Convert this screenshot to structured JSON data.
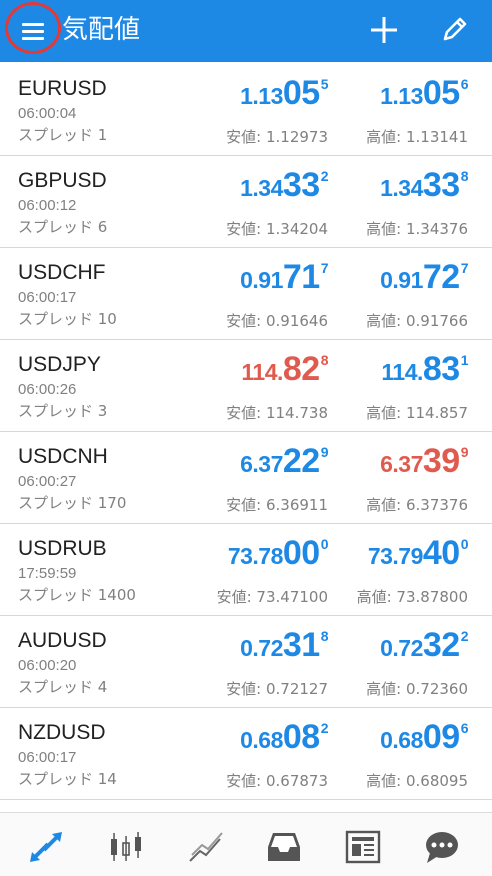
{
  "header": {
    "title": "気配値"
  },
  "colors": {
    "appbar": "#1e88e5",
    "up": "#1e88e5",
    "down": "#e05a4e",
    "highlight_ring": "#e53935"
  },
  "quotes": [
    {
      "symbol": "EURUSD",
      "time": "06:00:04",
      "spread": "スプレッド 1",
      "bid": {
        "small": "1.13",
        "big": "05",
        "sup": "5",
        "dir": "up"
      },
      "ask": {
        "small": "1.13",
        "big": "05",
        "sup": "6",
        "dir": "up"
      },
      "low": "安値: 1.12973",
      "high": "高値: 1.13141"
    },
    {
      "symbol": "GBPUSD",
      "time": "06:00:12",
      "spread": "スプレッド 6",
      "bid": {
        "small": "1.34",
        "big": "33",
        "sup": "2",
        "dir": "up"
      },
      "ask": {
        "small": "1.34",
        "big": "33",
        "sup": "8",
        "dir": "up"
      },
      "low": "安値: 1.34204",
      "high": "高値: 1.34376"
    },
    {
      "symbol": "USDCHF",
      "time": "06:00:17",
      "spread": "スプレッド 10",
      "bid": {
        "small": "0.91",
        "big": "71",
        "sup": "7",
        "dir": "up"
      },
      "ask": {
        "small": "0.91",
        "big": "72",
        "sup": "7",
        "dir": "up"
      },
      "low": "安値: 0.91646",
      "high": "高値: 0.91766"
    },
    {
      "symbol": "USDJPY",
      "time": "06:00:26",
      "spread": "スプレッド 3",
      "bid": {
        "small": "114.",
        "big": "82",
        "sup": "8",
        "dir": "down"
      },
      "ask": {
        "small": "114.",
        "big": "83",
        "sup": "1",
        "dir": "up"
      },
      "low": "安値: 114.738",
      "high": "高値: 114.857"
    },
    {
      "symbol": "USDCNH",
      "time": "06:00:27",
      "spread": "スプレッド 170",
      "bid": {
        "small": "6.37",
        "big": "22",
        "sup": "9",
        "dir": "up"
      },
      "ask": {
        "small": "6.37",
        "big": "39",
        "sup": "9",
        "dir": "down"
      },
      "low": "安値: 6.36911",
      "high": "高値: 6.37376"
    },
    {
      "symbol": "USDRUB",
      "time": "17:59:59",
      "spread": "スプレッド 1400",
      "bid": {
        "small": "73.78",
        "big": "00",
        "sup": "0",
        "dir": "up"
      },
      "ask": {
        "small": "73.79",
        "big": "40",
        "sup": "0",
        "dir": "up"
      },
      "low": "安値: 73.47100",
      "high": "高値: 73.87800"
    },
    {
      "symbol": "AUDUSD",
      "time": "06:00:20",
      "spread": "スプレッド 4",
      "bid": {
        "small": "0.72",
        "big": "31",
        "sup": "8",
        "dir": "up"
      },
      "ask": {
        "small": "0.72",
        "big": "32",
        "sup": "2",
        "dir": "up"
      },
      "low": "安値: 0.72127",
      "high": "高値: 0.72360"
    },
    {
      "symbol": "NZDUSD",
      "time": "06:00:17",
      "spread": "スプレッド 14",
      "bid": {
        "small": "0.68",
        "big": "08",
        "sup": "2",
        "dir": "up"
      },
      "ask": {
        "small": "0.68",
        "big": "09",
        "sup": "6",
        "dir": "up"
      },
      "low": "安値: 0.67873",
      "high": "高値: 0.68095"
    }
  ],
  "nav": [
    {
      "id": "quotes",
      "icon": "arrows-icon",
      "active": true
    },
    {
      "id": "chart",
      "icon": "candlestick-icon",
      "active": false
    },
    {
      "id": "trade",
      "icon": "trend-icon",
      "active": false
    },
    {
      "id": "history",
      "icon": "inbox-icon",
      "active": false
    },
    {
      "id": "news",
      "icon": "newspaper-icon",
      "active": false
    },
    {
      "id": "chat",
      "icon": "chat-bubble-icon",
      "active": false
    }
  ]
}
